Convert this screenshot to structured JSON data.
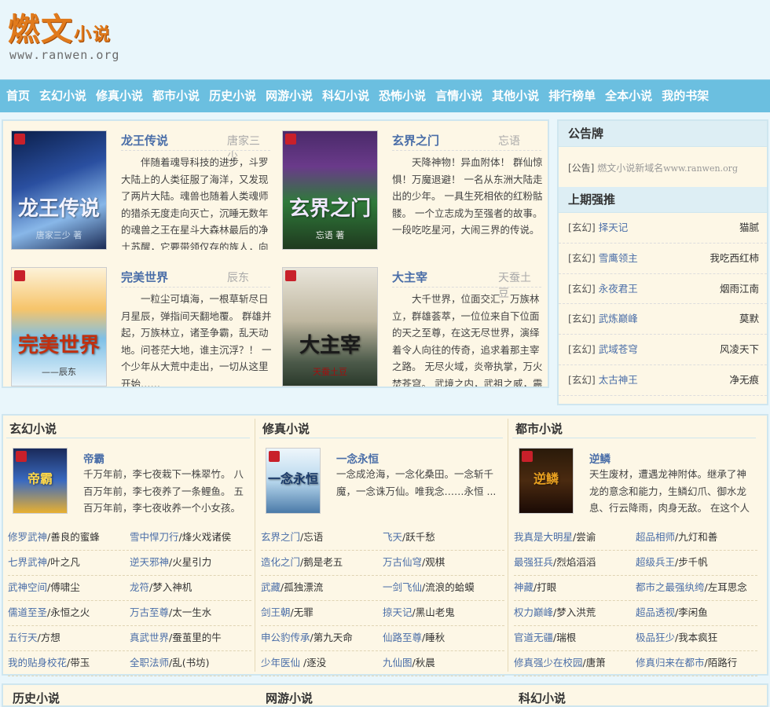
{
  "logo": {
    "cn_main": "燃文",
    "cn_small": "小说",
    "url": "www.ranwen.org"
  },
  "nav": [
    "首页",
    "玄幻小说",
    "修真小说",
    "都市小说",
    "历史小说",
    "网游小说",
    "科幻小说",
    "恐怖小说",
    "言情小说",
    "其他小说",
    "排行榜单",
    "全本小说",
    "我的书架"
  ],
  "featured": [
    {
      "title": "龙王传说",
      "author": "唐家三少",
      "desc": "伴随着魂导科技的进步，斗罗大陆上的人类征服了海洋，又发现了两片大陆。魂兽也随着人类魂师的猎杀无度走向灭亡，沉睡无数年的魂兽之王在星斗大森林最后的净土苏醒，它要带领仅存的族人，向",
      "cover_text": "龙王传说",
      "cover_sub": "唐家三少 著"
    },
    {
      "title": "玄界之门",
      "author": "忘语",
      "desc": "天降神物！异血附体！ 群仙惊惧！万魔退避！ 一名从东洲大陆走出的少年。 一具生死相依的红粉骷髅。 一个立志成为至强者的故事。 一段吃吃星河，大闹三界的传说。",
      "cover_text": "玄界之门",
      "cover_sub": "忘语 著"
    },
    {
      "title": "完美世界",
      "author": "辰东",
      "desc": "一粒尘可填海，一根草斩尽日月星辰，弹指间天翻地覆。 群雄并起，万族林立，诸圣争霸，乱天动地。问苍茫大地，谁主沉浮？！ 一个少年从大荒中走出，一切从这里开始……",
      "cover_text": "完美世界",
      "cover_sub": "——辰东"
    },
    {
      "title": "大主宰",
      "author": "天蚕土豆",
      "desc": "大千世界，位面交汇，万族林立，群雄荟萃，一位位来自下位面的天之至尊，在这无尽世界，演绎着令人向往的传奇，追求着那主宰之路。 无尽火域，炎帝执掌，万火焚苍穹。 武境之内，武祖之威，震",
      "cover_text": "大主宰",
      "cover_sub": "天蚕土豆"
    }
  ],
  "sidebar": {
    "notice_head": "公告牌",
    "notice_tag": "[公告]",
    "notice_text": "燃文小说新域名",
    "notice_url": "www.ranwen.org",
    "rank_head": "上期强推",
    "rank": [
      {
        "cat": "[玄幻]",
        "title": "择天记",
        "author": "猫腻"
      },
      {
        "cat": "[玄幻]",
        "title": "雪鹰领主",
        "author": "我吃西红柿"
      },
      {
        "cat": "[玄幻]",
        "title": "永夜君王",
        "author": "烟雨江南"
      },
      {
        "cat": "[玄幻]",
        "title": "武炼巅峰",
        "author": "莫默"
      },
      {
        "cat": "[玄幻]",
        "title": "武域苍穹",
        "author": "风凌天下"
      },
      {
        "cat": "[玄幻]",
        "title": "太古神王",
        "author": "净无痕"
      }
    ]
  },
  "categories": [
    {
      "head": "玄幻小说",
      "feat_title": "帝霸",
      "feat_desc": "千万年前，李七夜栽下一株翠竹。 八百万年前，李七夜养了一条鲤鱼。 五百万年前，李七夜收养一个小女孩。 今天，",
      "cover_text": "帝霸",
      "list": [
        {
          "t": "修罗武神",
          "a": "善良的蜜蜂"
        },
        {
          "t": "雪中悍刀行",
          "a": "烽火戏诸侯"
        },
        {
          "t": "七界武神",
          "a": "叶之凡"
        },
        {
          "t": "逆天邪神",
          "a": "火星引力"
        },
        {
          "t": "武神空间",
          "a": "傅啸尘"
        },
        {
          "t": "龙符",
          "a": "梦入神机"
        },
        {
          "t": "儒道至圣",
          "a": "永恒之火"
        },
        {
          "t": "万古至尊",
          "a": "太一生水"
        },
        {
          "t": "五行天",
          "a": "方想"
        },
        {
          "t": "真武世界",
          "a": "蚕茧里的牛"
        },
        {
          "t": "我的贴身校花",
          "a": "带玉"
        },
        {
          "t": "全职法师",
          "a": "乱(书坊)"
        }
      ]
    },
    {
      "head": "修真小说",
      "feat_title": "一念永恒",
      "feat_desc": "一念成沧海，一念化桑田。一念斩千魔，一念诛万仙。唯我念……永恒 ...",
      "cover_text": "一念永恒",
      "list": [
        {
          "t": "玄界之门",
          "a": "忘语"
        },
        {
          "t": "飞天",
          "a": "跃千愁"
        },
        {
          "t": "造化之门",
          "a": "鹅是老五"
        },
        {
          "t": "万古仙穹",
          "a": "观棋"
        },
        {
          "t": "武藏",
          "a": "孤独漂流"
        },
        {
          "t": "一剑飞仙",
          "a": "流浪的蛤蟆"
        },
        {
          "t": "剑王朝",
          "a": "无罪"
        },
        {
          "t": "掠天记",
          "a": "黑山老鬼"
        },
        {
          "t": "申公豹传承",
          "a": "第九天命"
        },
        {
          "t": "仙路至尊",
          "a": "睡秋"
        },
        {
          "t": "少年医仙 ",
          "a": "逐没"
        },
        {
          "t": "九仙图",
          "a": "秋晨"
        }
      ]
    },
    {
      "head": "都市小说",
      "feat_title": "逆鳞",
      "feat_desc": "天生废材，遭遇龙神附体。继承了神龙的意念和能力，生鳞幻爪、御水龙息、行云降雨，肉身无敌。 在这个人人都想屠龙",
      "cover_text": "逆鳞",
      "list": [
        {
          "t": "我真是大明星",
          "a": "尝谕"
        },
        {
          "t": "超品相师",
          "a": "九灯和善"
        },
        {
          "t": "最强狂兵",
          "a": "烈焰滔滔"
        },
        {
          "t": "超级兵王",
          "a": "步千帆"
        },
        {
          "t": "神藏",
          "a": "打眼"
        },
        {
          "t": "都市之最强纨绔",
          "a": "左耳思念"
        },
        {
          "t": "权力巅峰",
          "a": "梦入洪荒"
        },
        {
          "t": "超品透视",
          "a": "李闲鱼"
        },
        {
          "t": "官道无疆",
          "a": "瑞根"
        },
        {
          "t": "极品狂少",
          "a": "我本疯狂"
        },
        {
          "t": "修真强少在校园",
          "a": "唐箫"
        },
        {
          "t": "修真归来在都市",
          "a": "陌路行"
        }
      ]
    }
  ],
  "bottom_heads": [
    "历史小说",
    "网游小说",
    "科幻小说"
  ]
}
